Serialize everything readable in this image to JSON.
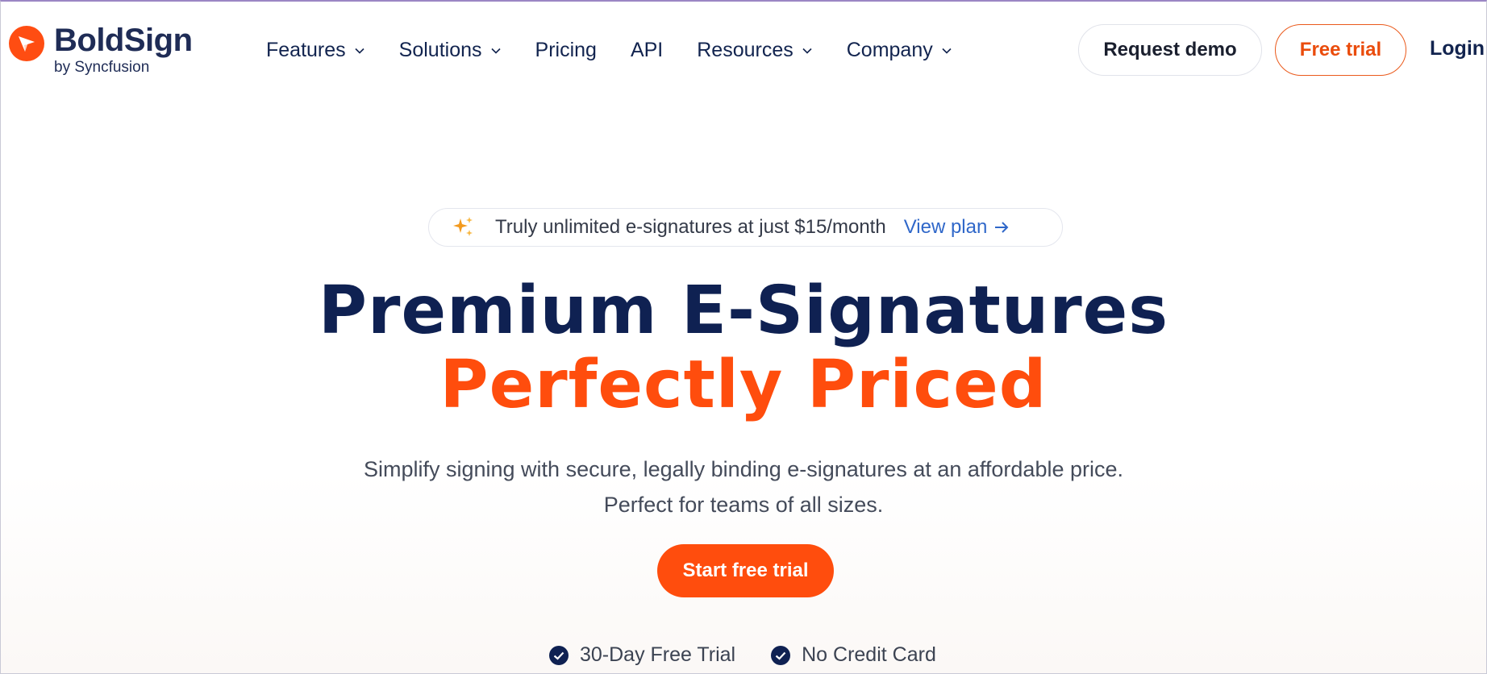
{
  "brand": {
    "name": "BoldSign",
    "sub": "by Syncfusion",
    "color": "#ff4d12"
  },
  "nav": {
    "items": [
      {
        "label": "Features",
        "dropdown": true
      },
      {
        "label": "Solutions",
        "dropdown": true
      },
      {
        "label": "Pricing",
        "dropdown": false
      },
      {
        "label": "API",
        "dropdown": false
      },
      {
        "label": "Resources",
        "dropdown": true
      },
      {
        "label": "Company",
        "dropdown": true
      }
    ]
  },
  "header_actions": {
    "request_demo": "Request demo",
    "free_trial": "Free trial",
    "login": "Login"
  },
  "announcement": {
    "icon": "sparkle-icon",
    "text": "Truly unlimited e-signatures at just $15/month",
    "link": "View plan",
    "link_icon": "arrow-right-icon"
  },
  "hero": {
    "title": "Premium E-Signatures",
    "accent": "Perfectly Priced",
    "description_line1": "Simplify signing with secure, legally binding e-signatures at an affordable price.",
    "description_line2": "Perfect for teams of all sizes.",
    "cta": "Start free trial"
  },
  "features": [
    {
      "icon": "check-circle-icon",
      "label": "30-Day Free Trial"
    },
    {
      "icon": "check-circle-icon",
      "label": "No Credit Card"
    }
  ],
  "colors": {
    "accent": "#ff4d0d",
    "navy": "#0f2152",
    "link": "#2f67c9"
  }
}
